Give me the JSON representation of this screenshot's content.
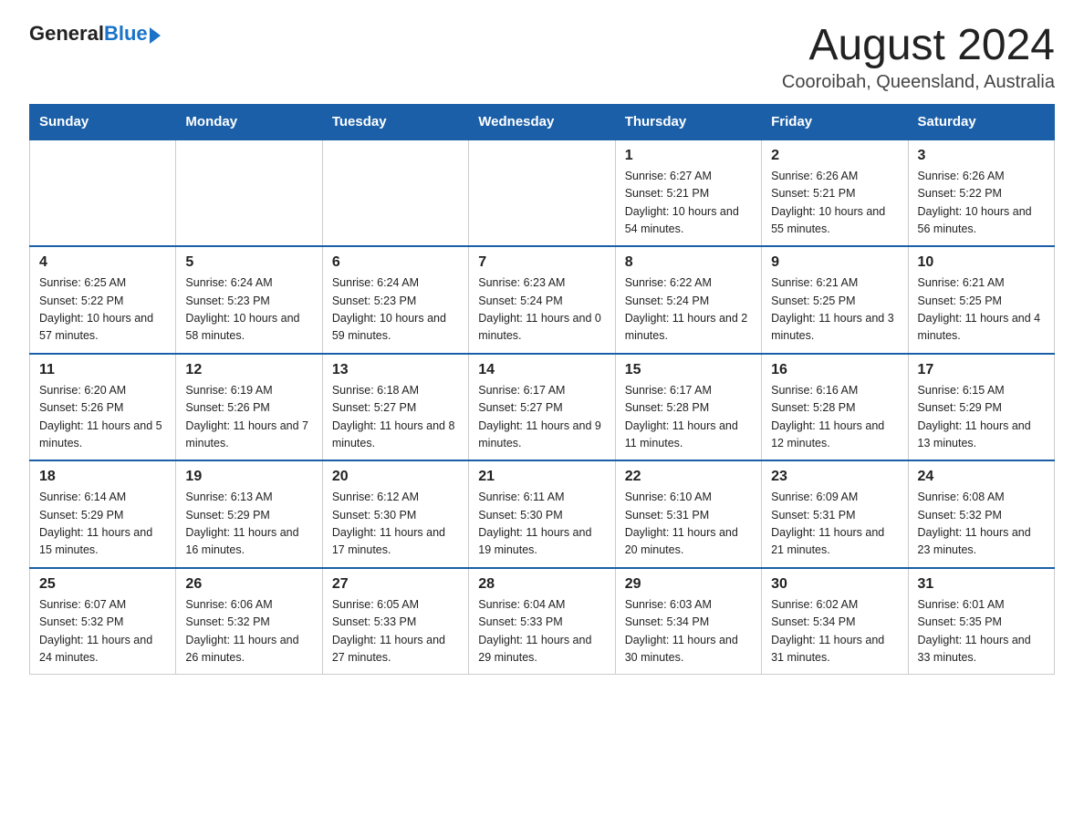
{
  "logo": {
    "general": "General",
    "blue": "Blue"
  },
  "header": {
    "title": "August 2024",
    "location": "Cooroibah, Queensland, Australia"
  },
  "days_of_week": [
    "Sunday",
    "Monday",
    "Tuesday",
    "Wednesday",
    "Thursday",
    "Friday",
    "Saturday"
  ],
  "weeks": [
    [
      {
        "day": "",
        "info": ""
      },
      {
        "day": "",
        "info": ""
      },
      {
        "day": "",
        "info": ""
      },
      {
        "day": "",
        "info": ""
      },
      {
        "day": "1",
        "info": "Sunrise: 6:27 AM\nSunset: 5:21 PM\nDaylight: 10 hours and 54 minutes."
      },
      {
        "day": "2",
        "info": "Sunrise: 6:26 AM\nSunset: 5:21 PM\nDaylight: 10 hours and 55 minutes."
      },
      {
        "day": "3",
        "info": "Sunrise: 6:26 AM\nSunset: 5:22 PM\nDaylight: 10 hours and 56 minutes."
      }
    ],
    [
      {
        "day": "4",
        "info": "Sunrise: 6:25 AM\nSunset: 5:22 PM\nDaylight: 10 hours and 57 minutes."
      },
      {
        "day": "5",
        "info": "Sunrise: 6:24 AM\nSunset: 5:23 PM\nDaylight: 10 hours and 58 minutes."
      },
      {
        "day": "6",
        "info": "Sunrise: 6:24 AM\nSunset: 5:23 PM\nDaylight: 10 hours and 59 minutes."
      },
      {
        "day": "7",
        "info": "Sunrise: 6:23 AM\nSunset: 5:24 PM\nDaylight: 11 hours and 0 minutes."
      },
      {
        "day": "8",
        "info": "Sunrise: 6:22 AM\nSunset: 5:24 PM\nDaylight: 11 hours and 2 minutes."
      },
      {
        "day": "9",
        "info": "Sunrise: 6:21 AM\nSunset: 5:25 PM\nDaylight: 11 hours and 3 minutes."
      },
      {
        "day": "10",
        "info": "Sunrise: 6:21 AM\nSunset: 5:25 PM\nDaylight: 11 hours and 4 minutes."
      }
    ],
    [
      {
        "day": "11",
        "info": "Sunrise: 6:20 AM\nSunset: 5:26 PM\nDaylight: 11 hours and 5 minutes."
      },
      {
        "day": "12",
        "info": "Sunrise: 6:19 AM\nSunset: 5:26 PM\nDaylight: 11 hours and 7 minutes."
      },
      {
        "day": "13",
        "info": "Sunrise: 6:18 AM\nSunset: 5:27 PM\nDaylight: 11 hours and 8 minutes."
      },
      {
        "day": "14",
        "info": "Sunrise: 6:17 AM\nSunset: 5:27 PM\nDaylight: 11 hours and 9 minutes."
      },
      {
        "day": "15",
        "info": "Sunrise: 6:17 AM\nSunset: 5:28 PM\nDaylight: 11 hours and 11 minutes."
      },
      {
        "day": "16",
        "info": "Sunrise: 6:16 AM\nSunset: 5:28 PM\nDaylight: 11 hours and 12 minutes."
      },
      {
        "day": "17",
        "info": "Sunrise: 6:15 AM\nSunset: 5:29 PM\nDaylight: 11 hours and 13 minutes."
      }
    ],
    [
      {
        "day": "18",
        "info": "Sunrise: 6:14 AM\nSunset: 5:29 PM\nDaylight: 11 hours and 15 minutes."
      },
      {
        "day": "19",
        "info": "Sunrise: 6:13 AM\nSunset: 5:29 PM\nDaylight: 11 hours and 16 minutes."
      },
      {
        "day": "20",
        "info": "Sunrise: 6:12 AM\nSunset: 5:30 PM\nDaylight: 11 hours and 17 minutes."
      },
      {
        "day": "21",
        "info": "Sunrise: 6:11 AM\nSunset: 5:30 PM\nDaylight: 11 hours and 19 minutes."
      },
      {
        "day": "22",
        "info": "Sunrise: 6:10 AM\nSunset: 5:31 PM\nDaylight: 11 hours and 20 minutes."
      },
      {
        "day": "23",
        "info": "Sunrise: 6:09 AM\nSunset: 5:31 PM\nDaylight: 11 hours and 21 minutes."
      },
      {
        "day": "24",
        "info": "Sunrise: 6:08 AM\nSunset: 5:32 PM\nDaylight: 11 hours and 23 minutes."
      }
    ],
    [
      {
        "day": "25",
        "info": "Sunrise: 6:07 AM\nSunset: 5:32 PM\nDaylight: 11 hours and 24 minutes."
      },
      {
        "day": "26",
        "info": "Sunrise: 6:06 AM\nSunset: 5:32 PM\nDaylight: 11 hours and 26 minutes."
      },
      {
        "day": "27",
        "info": "Sunrise: 6:05 AM\nSunset: 5:33 PM\nDaylight: 11 hours and 27 minutes."
      },
      {
        "day": "28",
        "info": "Sunrise: 6:04 AM\nSunset: 5:33 PM\nDaylight: 11 hours and 29 minutes."
      },
      {
        "day": "29",
        "info": "Sunrise: 6:03 AM\nSunset: 5:34 PM\nDaylight: 11 hours and 30 minutes."
      },
      {
        "day": "30",
        "info": "Sunrise: 6:02 AM\nSunset: 5:34 PM\nDaylight: 11 hours and 31 minutes."
      },
      {
        "day": "31",
        "info": "Sunrise: 6:01 AM\nSunset: 5:35 PM\nDaylight: 11 hours and 33 minutes."
      }
    ]
  ]
}
